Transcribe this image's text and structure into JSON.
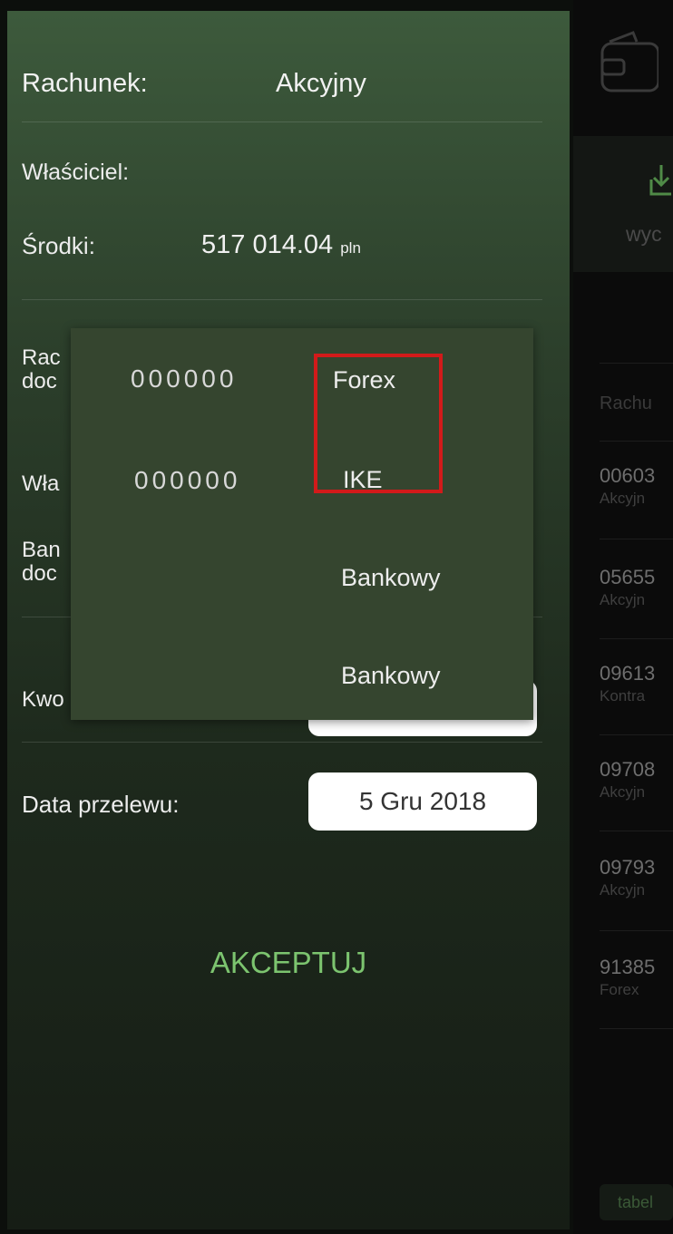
{
  "form": {
    "account_label": "Rachunek:",
    "account_value": "Akcyjny",
    "owner_label": "Właściciel:",
    "funds_label": "Środki:",
    "funds_amount": "517 014.04",
    "funds_currency": "pln",
    "target_account_label_line1": "Rac",
    "target_account_label_line2": "doc",
    "target_owner_label": "Wła",
    "target_bank_label_line1": "Ban",
    "target_bank_label_line2": "doc",
    "amount_label": "Kwo",
    "date_label": "Data przelewu:",
    "date_value": "5 Gru 2018",
    "accept_label": "AKCEPTUJ"
  },
  "popup": {
    "items": [
      {
        "number": "000000",
        "type": "Forex"
      },
      {
        "number": "000000",
        "type": "IKE"
      },
      {
        "number": "",
        "type": "Bankowy"
      },
      {
        "number": "",
        "type": "Bankowy"
      }
    ]
  },
  "right_panel": {
    "partial_label": "wyc",
    "column_header": "Rachu",
    "rows": [
      {
        "number": "00603",
        "type": "Akcyjn"
      },
      {
        "number": "05655",
        "type": "Akcyjn"
      },
      {
        "number": "09613",
        "type": "Kontra"
      },
      {
        "number": "09708",
        "type": "Akcyjn"
      },
      {
        "number": "09793",
        "type": "Akcyjn"
      },
      {
        "number": "91385",
        "type": "Forex"
      }
    ],
    "bottom_label": "tabel"
  },
  "colors": {
    "accent_green": "#7cc46f",
    "highlight_red": "#d21a1a",
    "popup_bg": "#35452f"
  },
  "icons": [
    "wallet-icon",
    "download-icon"
  ]
}
